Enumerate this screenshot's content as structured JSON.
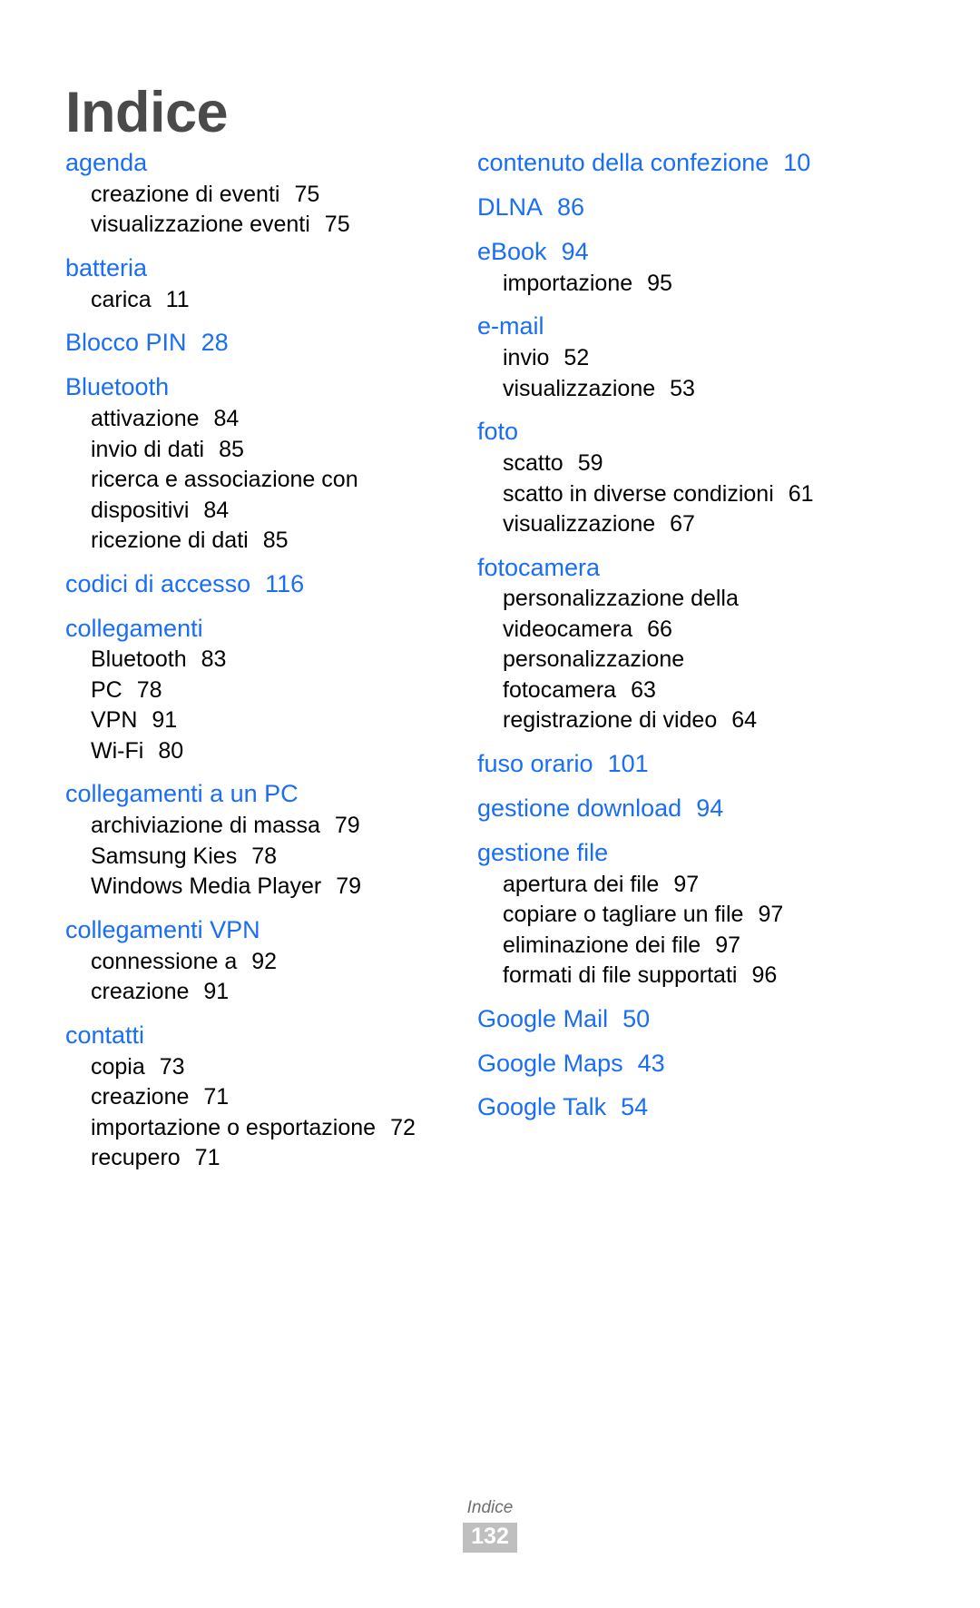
{
  "title": "Indice",
  "colors": {
    "heading_blue": "#1a6ef5",
    "title_gray": "#4a4a4a",
    "body_black": "#000000",
    "footer_gray": "#6f6f6f",
    "page_badge_bg": "#bfbfbf"
  },
  "footer": {
    "label": "Indice",
    "page_number": "132"
  },
  "columns": [
    {
      "name": "left",
      "entries": [
        {
          "term": "agenda",
          "page": "",
          "subs": [
            {
              "text": "creazione di eventi",
              "page": "75"
            },
            {
              "text": "visualizzazione eventi",
              "page": "75"
            }
          ]
        },
        {
          "term": "batteria",
          "page": "",
          "subs": [
            {
              "text": "carica",
              "page": "11"
            }
          ]
        },
        {
          "term": "Blocco PIN",
          "page": "28",
          "subs": []
        },
        {
          "term": "Bluetooth",
          "page": "",
          "subs": [
            {
              "text": "attivazione",
              "page": "84"
            },
            {
              "text": "invio di dati",
              "page": "85"
            },
            {
              "text": "ricerca e associazione con dispositivi",
              "page": "84"
            },
            {
              "text": "ricezione di dati",
              "page": "85"
            }
          ]
        },
        {
          "term": "codici di accesso",
          "page": "116",
          "subs": []
        },
        {
          "term": "collegamenti",
          "page": "",
          "subs": [
            {
              "text": "Bluetooth",
              "page": "83"
            },
            {
              "text": "PC",
              "page": "78"
            },
            {
              "text": "VPN",
              "page": "91"
            },
            {
              "text": "Wi-Fi",
              "page": "80"
            }
          ]
        },
        {
          "term": "collegamenti a un PC",
          "page": "",
          "subs": [
            {
              "text": "archiviazione di massa",
              "page": "79"
            },
            {
              "text": "Samsung Kies",
              "page": "78"
            },
            {
              "text": "Windows Media Player",
              "page": "79"
            }
          ]
        },
        {
          "term": "collegamenti VPN",
          "page": "",
          "subs": [
            {
              "text": "connessione a",
              "page": "92"
            },
            {
              "text": "creazione",
              "page": "91"
            }
          ]
        },
        {
          "term": "contatti",
          "page": "",
          "subs": [
            {
              "text": "copia",
              "page": "73"
            },
            {
              "text": "creazione",
              "page": "71"
            },
            {
              "text": "importazione o esportazione",
              "page": "72"
            },
            {
              "text": "recupero",
              "page": "71"
            }
          ]
        }
      ]
    },
    {
      "name": "right",
      "entries": [
        {
          "term": "contenuto della confezione",
          "page": "10",
          "subs": []
        },
        {
          "term": "DLNA",
          "page": "86",
          "subs": []
        },
        {
          "term": "eBook",
          "page": "94",
          "subs": [
            {
              "text": "importazione",
              "page": "95"
            }
          ]
        },
        {
          "term": "e-mail",
          "page": "",
          "subs": [
            {
              "text": "invio",
              "page": "52"
            },
            {
              "text": "visualizzazione",
              "page": "53"
            }
          ]
        },
        {
          "term": "foto",
          "page": "",
          "subs": [
            {
              "text": "scatto",
              "page": "59"
            },
            {
              "text": "scatto in diverse condizioni",
              "page": "61"
            },
            {
              "text": "visualizzazione",
              "page": "67"
            }
          ]
        },
        {
          "term": "fotocamera",
          "page": "",
          "subs": [
            {
              "text": "personalizzazione della videocamera",
              "page": "66"
            },
            {
              "text": "personalizzazione fotocamera",
              "page": "63"
            },
            {
              "text": "registrazione di video",
              "page": "64"
            }
          ]
        },
        {
          "term": "fuso orario",
          "page": "101",
          "subs": []
        },
        {
          "term": "gestione download",
          "page": "94",
          "subs": []
        },
        {
          "term": "gestione file",
          "page": "",
          "subs": [
            {
              "text": "apertura dei file",
              "page": "97"
            },
            {
              "text": "copiare o tagliare un file",
              "page": "97"
            },
            {
              "text": "eliminazione dei file",
              "page": "97"
            },
            {
              "text": "formati di file supportati",
              "page": "96"
            }
          ]
        },
        {
          "term": "Google Mail",
          "page": "50",
          "subs": []
        },
        {
          "term": "Google Maps",
          "page": "43",
          "subs": []
        },
        {
          "term": "Google Talk",
          "page": "54",
          "subs": []
        }
      ]
    }
  ]
}
